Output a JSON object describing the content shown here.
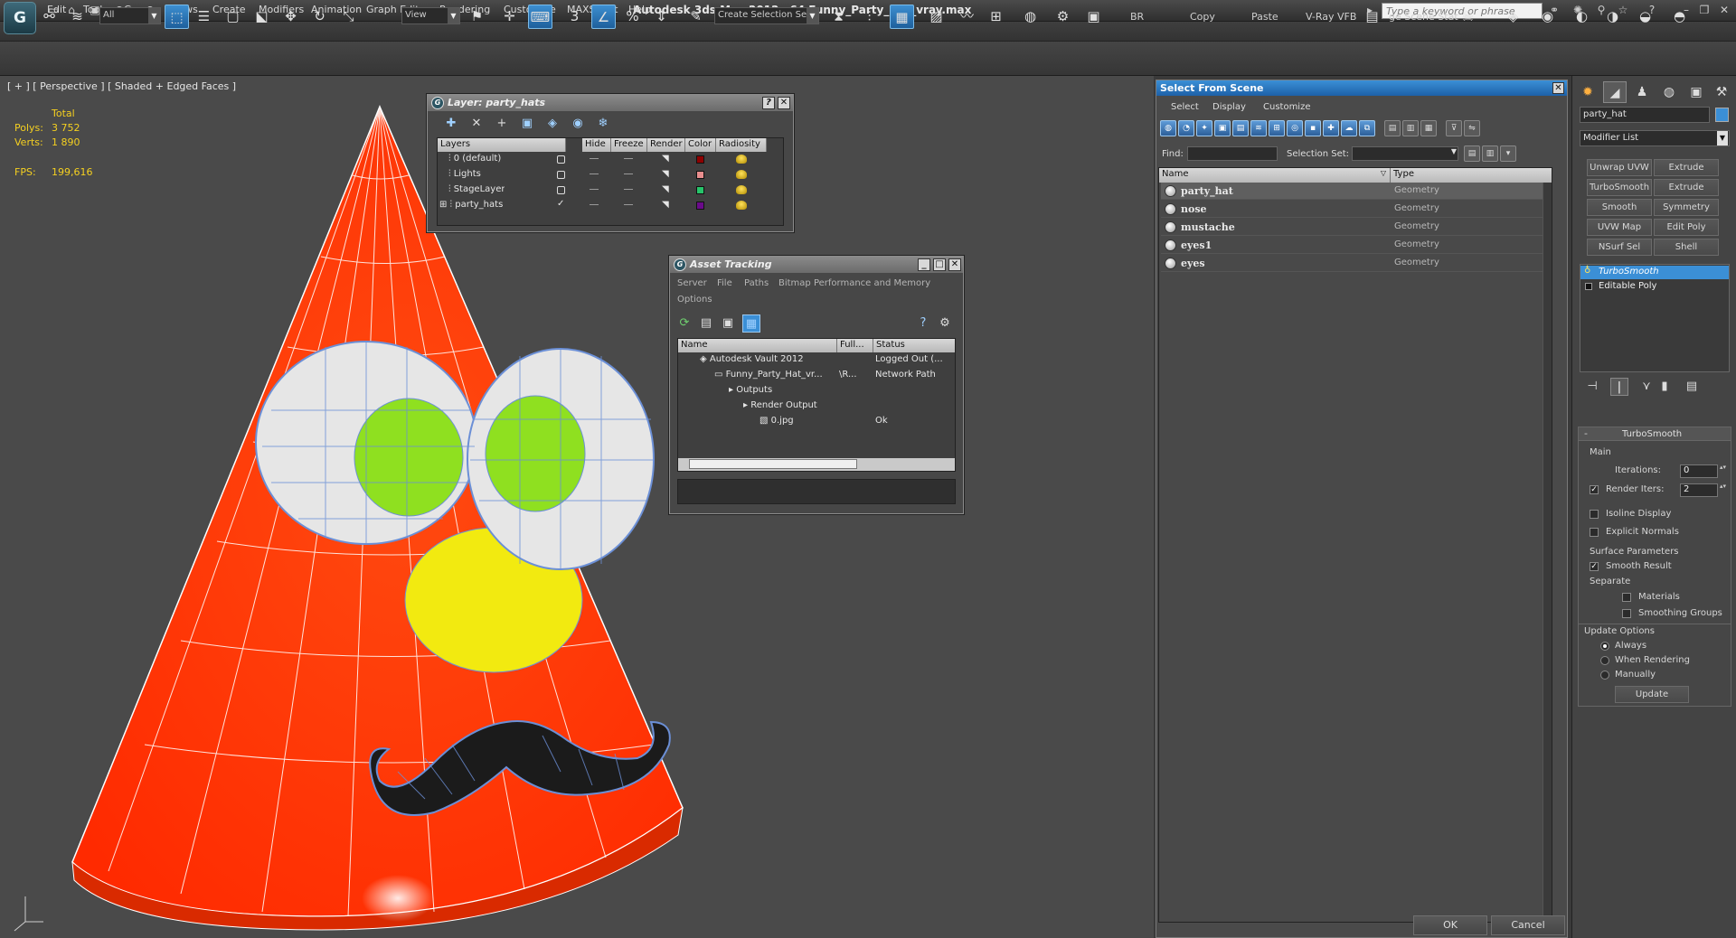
{
  "window": {
    "logo": "G",
    "title": "Autodesk 3ds Max  2012 x64      Funny_Party_Hat_vray.max",
    "search_placeholder": "Type a keyword or phrase"
  },
  "menu": [
    "Edit",
    "Tools",
    "Group",
    "Views",
    "Create",
    "Modifiers",
    "Animation",
    "Graph Editors",
    "Rendering",
    "Customize",
    "MAXScript",
    "Help"
  ],
  "toolbar": {
    "filter_all": "All",
    "view_mode": "View",
    "snap_3": "3",
    "selection_set_placeholder": "Create Selection Se",
    "br_label": "BR",
    "copy_label": "Copy",
    "paste_label": "Paste",
    "vray_vfb_label": "V-Ray VFB",
    "scene_stat_label": "ge Scene Stat"
  },
  "viewport": {
    "label": "[ + ] [ Perspective ] [ Shaded + Edged Faces ]",
    "stats": {
      "total_label": "Total",
      "polys_label": "Polys:",
      "polys_value": "3 752",
      "verts_label": "Verts:",
      "verts_value": "1 890",
      "fps_label": "FPS:",
      "fps_value": "199,616"
    },
    "colors": {
      "hat": "#ff3a06",
      "eyes": "#e6e6e6",
      "pupils": "#8fe020",
      "nose": "#f2ea10",
      "mustache": "#1b1b1b",
      "wire": "#6b8fd6"
    }
  },
  "layer_panel": {
    "title": "Layer: party_hats",
    "headers": [
      "Layers",
      "Hide",
      "Freeze",
      "Render",
      "Color",
      "Radiosity"
    ],
    "rows": [
      {
        "name": "0 (default)",
        "color": "#8e0000"
      },
      {
        "name": "Lights",
        "color": "#e88e8e"
      },
      {
        "name": "StageLayer",
        "color": "#27c46a"
      },
      {
        "name": "party_hats",
        "color": "#6a0a8a"
      }
    ]
  },
  "asset_tracking": {
    "title": "Asset Tracking",
    "menus": [
      "Server",
      "File",
      "Paths",
      "Bitmap Performance and Memory",
      "Options"
    ],
    "headers": [
      "Name",
      "Full...",
      "Status"
    ],
    "rows": [
      {
        "name": "Autodesk Vault 2012",
        "full": "",
        "status": "Logged Out (...",
        "indent": 1
      },
      {
        "name": "Funny_Party_Hat_vr...",
        "full": "\\R...",
        "status": "Network Path",
        "indent": 2
      },
      {
        "name": "Outputs",
        "full": "",
        "status": "",
        "indent": 3
      },
      {
        "name": "Render Output",
        "full": "",
        "status": "",
        "indent": 4
      },
      {
        "name": "0.jpg",
        "full": "",
        "status": "Ok",
        "indent": 5
      }
    ]
  },
  "select_from_scene": {
    "title": "Select From Scene",
    "menus": [
      "Select",
      "Display",
      "Customize"
    ],
    "find_label": "Find:",
    "selection_set_label": "Selection Set:",
    "headers": [
      "Name",
      "Type"
    ],
    "rows": [
      {
        "name": "party_hat",
        "type": "Geometry"
      },
      {
        "name": "nose",
        "type": "Geometry"
      },
      {
        "name": "mustache",
        "type": "Geometry"
      },
      {
        "name": "eyes1",
        "type": "Geometry"
      },
      {
        "name": "eyes",
        "type": "Geometry"
      }
    ],
    "ok_label": "OK",
    "cancel_label": "Cancel"
  },
  "command_panel": {
    "object_name": "party_hat",
    "object_color": "#3b8fd6",
    "modifier_list": "Modifier List",
    "modifier_buttons": [
      "Unwrap UVW",
      "Extrude",
      "TurboSmooth",
      "Extrude",
      "Smooth",
      "Symmetry",
      "UVW Map",
      "Edit Poly",
      "NSurf Sel",
      "Shell"
    ],
    "stack": [
      "TurboSmooth",
      "Editable Poly"
    ],
    "rollout_title": "TurboSmooth",
    "main_label": "Main",
    "iterations_label": "Iterations:",
    "iterations_value": "0",
    "render_iters_label": "Render Iters:",
    "render_iters_value": "2",
    "isoline_label": "Isoline Display",
    "explicit_normals_label": "Explicit Normals",
    "surface_params_label": "Surface Parameters",
    "smooth_result_label": "Smooth Result",
    "separate_label": "Separate",
    "materials_label": "Materials",
    "smoothing_groups_label": "Smoothing Groups",
    "update_options_label": "Update Options",
    "always_label": "Always",
    "when_rendering_label": "When Rendering",
    "manually_label": "Manually",
    "update_button": "Update"
  }
}
